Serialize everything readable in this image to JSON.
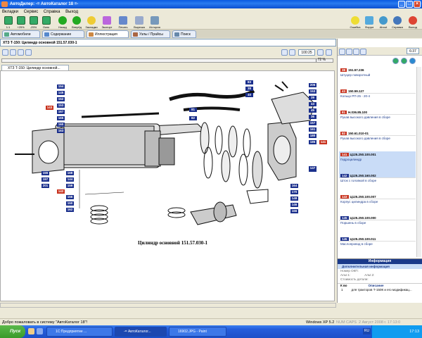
{
  "window": {
    "title": "АвтоДилер: -= АвтоКаталог 18 =-"
  },
  "menu": [
    "Вкладки",
    "Сервис",
    "Справка",
    "Выход"
  ],
  "toolbar": {
    "left": [
      "1:1",
      "+25%",
      "-25%",
      "Окно",
      "Назад",
      "Вперёд",
      "Закладки",
      "Экспорт",
      "Печать",
      "Вырезка",
      "История"
    ],
    "right": [
      "Ошибка",
      "Форум",
      "About",
      "Справка",
      "Выход"
    ]
  },
  "tabs": [
    "Автомобили",
    "Содержание",
    "Иллюстрация",
    "Узлы / Прайсы",
    "Поиск"
  ],
  "address": "ХТЗ Т-150: Цилиндр основной 151.57.030-1",
  "zoom": "100:25",
  "progress": "72 %",
  "doc_tab": "ХТЗ Т-150: Цилиндр основной...",
  "right_counter": "6:37",
  "drawing": {
    "caption": "Цилиндр основной 151.57.030-1"
  },
  "callouts": [
    {
      "t": "154",
      "r": 0
    },
    {
      "t": "145",
      "r": 0
    },
    {
      "t": "152",
      "r": 0
    },
    {
      "t": "153",
      "r": 0
    },
    {
      "t": "167",
      "r": 0
    },
    {
      "t": "165",
      "r": 0
    },
    {
      "t": "160",
      "r": 0
    },
    {
      "t": "163",
      "r": 0
    },
    {
      "t": "143",
      "r": 1
    },
    {
      "t": "81",
      "r": 0
    },
    {
      "t": "82",
      "r": 0
    },
    {
      "t": "83",
      "r": 0
    },
    {
      "t": "38",
      "r": 0
    },
    {
      "t": "40",
      "r": 0
    },
    {
      "t": "206",
      "r": 0
    },
    {
      "t": "153",
      "r": 0
    },
    {
      "t": "39",
      "r": 0
    },
    {
      "t": "43",
      "r": 0
    },
    {
      "t": "45",
      "r": 0
    },
    {
      "t": "36",
      "r": 0
    },
    {
      "t": "157",
      "r": 0
    },
    {
      "t": "161",
      "r": 0
    },
    {
      "t": "180",
      "r": 0
    },
    {
      "t": "185",
      "r": 0
    },
    {
      "t": "141",
      "r": 1
    },
    {
      "t": "149",
      "r": 0
    },
    {
      "t": "155",
      "r": 0
    },
    {
      "t": "197",
      "r": 0
    },
    {
      "t": "201",
      "r": 0
    },
    {
      "t": "168",
      "r": 0
    },
    {
      "t": "144",
      "r": 0
    },
    {
      "t": "159",
      "r": 0
    },
    {
      "t": "142",
      "r": 1
    },
    {
      "t": "156",
      "r": 0
    },
    {
      "t": "150",
      "r": 0
    },
    {
      "t": "162",
      "r": 0
    },
    {
      "t": "147",
      "r": 0
    },
    {
      "t": "164",
      "r": 0
    },
    {
      "t": "170",
      "r": 0
    },
    {
      "t": "148",
      "r": 0
    },
    {
      "t": "146",
      "r": 0
    },
    {
      "t": "166",
      "r": 0
    }
  ],
  "parts": [
    {
      "num": "38",
      "code": "151.57.236",
      "name": "Штуцер поворотный",
      "red": 1
    },
    {
      "num": "43",
      "code": "150.59.127",
      "name": "Кольцо РП-25 - 20-4",
      "red": 1
    },
    {
      "num": "81",
      "code": "Н.036.85.100",
      "name": "Рукав высокого давления в сборе",
      "red": 1
    },
    {
      "num": "82",
      "code": "150.61.010-01",
      "name": "Рукав высокого давления в сборе",
      "red": 1
    },
    {
      "num": "141",
      "code": "Ц125.250.100.001",
      "name": "Гидроцилиндр",
      "red": 1,
      "sel": 1
    },
    {
      "num": "142",
      "code": "Ц125.250.160.002",
      "name": "Шток с головкой в сборе",
      "red": 0
    },
    {
      "num": "143",
      "code": "Ц125.250.100.007",
      "name": "Корпус цилиндра в сборе",
      "red": 1
    },
    {
      "num": "145",
      "code": "Ц125.250.100.000",
      "name": "Поршень в сборе",
      "red": 0
    },
    {
      "num": "145",
      "code": "Ц125.250.100.011",
      "name": "Маслопровод в сборе",
      "red": 0
    }
  ],
  "info": {
    "header": "Информация",
    "title": "Дополнительная информация",
    "owner": "Номер ОКП:",
    "alt1": "Альт.1:",
    "alt2": "Альт.2:",
    "cost": "Стоимость детали:",
    "col_k": "К во",
    "col_desc": "Описание",
    "row_k": "1",
    "row_desc": "для тракторов Т-150К и его модификац..."
  },
  "status": {
    "text": "Добро пожаловать в систему \"АвтоКаталог 18\"!",
    "os": "Windows XP 5.2",
    "num": "NUM",
    "caps": "CAPS",
    "scrl": "SCRL",
    "date": "2 Август 2008 г. 17:13:0"
  },
  "taskbar": {
    "start": "Пуск",
    "items": [
      "1С:Предприятие ...",
      "-= АвтоКаталог...",
      "16902.JPG - Paint"
    ],
    "lang": "RU",
    "clock": "17:13"
  }
}
